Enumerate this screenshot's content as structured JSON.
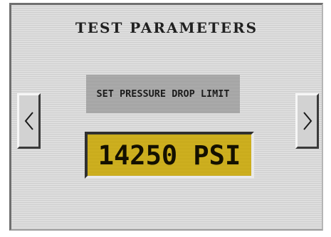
{
  "screen": {
    "title": "TEST PARAMETERS"
  },
  "prompt": {
    "label": "SET PRESSURE DROP LIMIT"
  },
  "value": {
    "display": "14250 PSI",
    "number": 14250,
    "unit": "PSI"
  },
  "navigation": {
    "previous_icon": "chevron-left-icon",
    "next_icon": "chevron-right-icon"
  },
  "colors": {
    "screen_background": "#dadada",
    "prompt_background": "#a9a9a9",
    "value_background": "#cdaf1e",
    "text": "#1c1c1c"
  }
}
